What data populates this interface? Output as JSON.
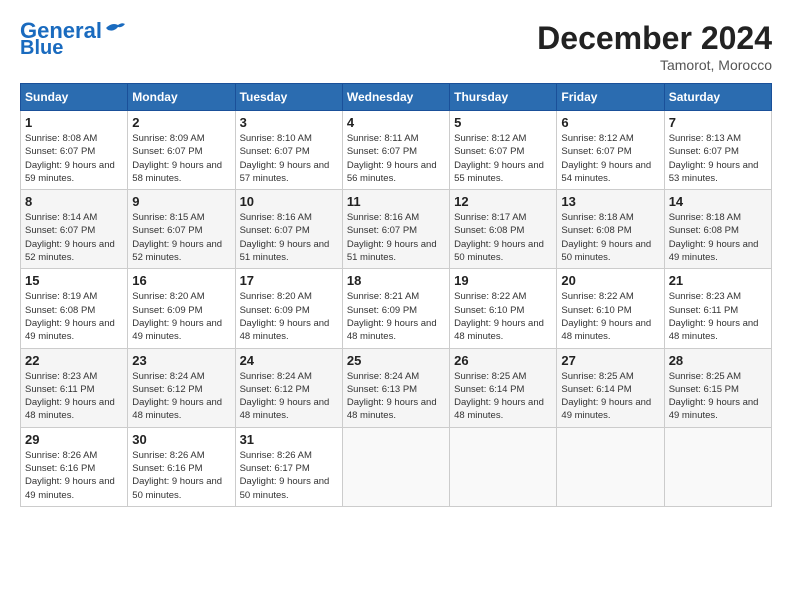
{
  "header": {
    "logo_line1": "General",
    "logo_line2": "Blue",
    "month": "December 2024",
    "location": "Tamorot, Morocco"
  },
  "days_of_week": [
    "Sunday",
    "Monday",
    "Tuesday",
    "Wednesday",
    "Thursday",
    "Friday",
    "Saturday"
  ],
  "weeks": [
    [
      {
        "day": "1",
        "sunrise": "8:08 AM",
        "sunset": "6:07 PM",
        "daylight": "9 hours and 59 minutes."
      },
      {
        "day": "2",
        "sunrise": "8:09 AM",
        "sunset": "6:07 PM",
        "daylight": "9 hours and 58 minutes."
      },
      {
        "day": "3",
        "sunrise": "8:10 AM",
        "sunset": "6:07 PM",
        "daylight": "9 hours and 57 minutes."
      },
      {
        "day": "4",
        "sunrise": "8:11 AM",
        "sunset": "6:07 PM",
        "daylight": "9 hours and 56 minutes."
      },
      {
        "day": "5",
        "sunrise": "8:12 AM",
        "sunset": "6:07 PM",
        "daylight": "9 hours and 55 minutes."
      },
      {
        "day": "6",
        "sunrise": "8:12 AM",
        "sunset": "6:07 PM",
        "daylight": "9 hours and 54 minutes."
      },
      {
        "day": "7",
        "sunrise": "8:13 AM",
        "sunset": "6:07 PM",
        "daylight": "9 hours and 53 minutes."
      }
    ],
    [
      {
        "day": "8",
        "sunrise": "8:14 AM",
        "sunset": "6:07 PM",
        "daylight": "9 hours and 52 minutes."
      },
      {
        "day": "9",
        "sunrise": "8:15 AM",
        "sunset": "6:07 PM",
        "daylight": "9 hours and 52 minutes."
      },
      {
        "day": "10",
        "sunrise": "8:16 AM",
        "sunset": "6:07 PM",
        "daylight": "9 hours and 51 minutes."
      },
      {
        "day": "11",
        "sunrise": "8:16 AM",
        "sunset": "6:07 PM",
        "daylight": "9 hours and 51 minutes."
      },
      {
        "day": "12",
        "sunrise": "8:17 AM",
        "sunset": "6:08 PM",
        "daylight": "9 hours and 50 minutes."
      },
      {
        "day": "13",
        "sunrise": "8:18 AM",
        "sunset": "6:08 PM",
        "daylight": "9 hours and 50 minutes."
      },
      {
        "day": "14",
        "sunrise": "8:18 AM",
        "sunset": "6:08 PM",
        "daylight": "9 hours and 49 minutes."
      }
    ],
    [
      {
        "day": "15",
        "sunrise": "8:19 AM",
        "sunset": "6:08 PM",
        "daylight": "9 hours and 49 minutes."
      },
      {
        "day": "16",
        "sunrise": "8:20 AM",
        "sunset": "6:09 PM",
        "daylight": "9 hours and 49 minutes."
      },
      {
        "day": "17",
        "sunrise": "8:20 AM",
        "sunset": "6:09 PM",
        "daylight": "9 hours and 48 minutes."
      },
      {
        "day": "18",
        "sunrise": "8:21 AM",
        "sunset": "6:09 PM",
        "daylight": "9 hours and 48 minutes."
      },
      {
        "day": "19",
        "sunrise": "8:22 AM",
        "sunset": "6:10 PM",
        "daylight": "9 hours and 48 minutes."
      },
      {
        "day": "20",
        "sunrise": "8:22 AM",
        "sunset": "6:10 PM",
        "daylight": "9 hours and 48 minutes."
      },
      {
        "day": "21",
        "sunrise": "8:23 AM",
        "sunset": "6:11 PM",
        "daylight": "9 hours and 48 minutes."
      }
    ],
    [
      {
        "day": "22",
        "sunrise": "8:23 AM",
        "sunset": "6:11 PM",
        "daylight": "9 hours and 48 minutes."
      },
      {
        "day": "23",
        "sunrise": "8:24 AM",
        "sunset": "6:12 PM",
        "daylight": "9 hours and 48 minutes."
      },
      {
        "day": "24",
        "sunrise": "8:24 AM",
        "sunset": "6:12 PM",
        "daylight": "9 hours and 48 minutes."
      },
      {
        "day": "25",
        "sunrise": "8:24 AM",
        "sunset": "6:13 PM",
        "daylight": "9 hours and 48 minutes."
      },
      {
        "day": "26",
        "sunrise": "8:25 AM",
        "sunset": "6:14 PM",
        "daylight": "9 hours and 48 minutes."
      },
      {
        "day": "27",
        "sunrise": "8:25 AM",
        "sunset": "6:14 PM",
        "daylight": "9 hours and 49 minutes."
      },
      {
        "day": "28",
        "sunrise": "8:25 AM",
        "sunset": "6:15 PM",
        "daylight": "9 hours and 49 minutes."
      }
    ],
    [
      {
        "day": "29",
        "sunrise": "8:26 AM",
        "sunset": "6:16 PM",
        "daylight": "9 hours and 49 minutes."
      },
      {
        "day": "30",
        "sunrise": "8:26 AM",
        "sunset": "6:16 PM",
        "daylight": "9 hours and 50 minutes."
      },
      {
        "day": "31",
        "sunrise": "8:26 AM",
        "sunset": "6:17 PM",
        "daylight": "9 hours and 50 minutes."
      },
      null,
      null,
      null,
      null
    ]
  ]
}
